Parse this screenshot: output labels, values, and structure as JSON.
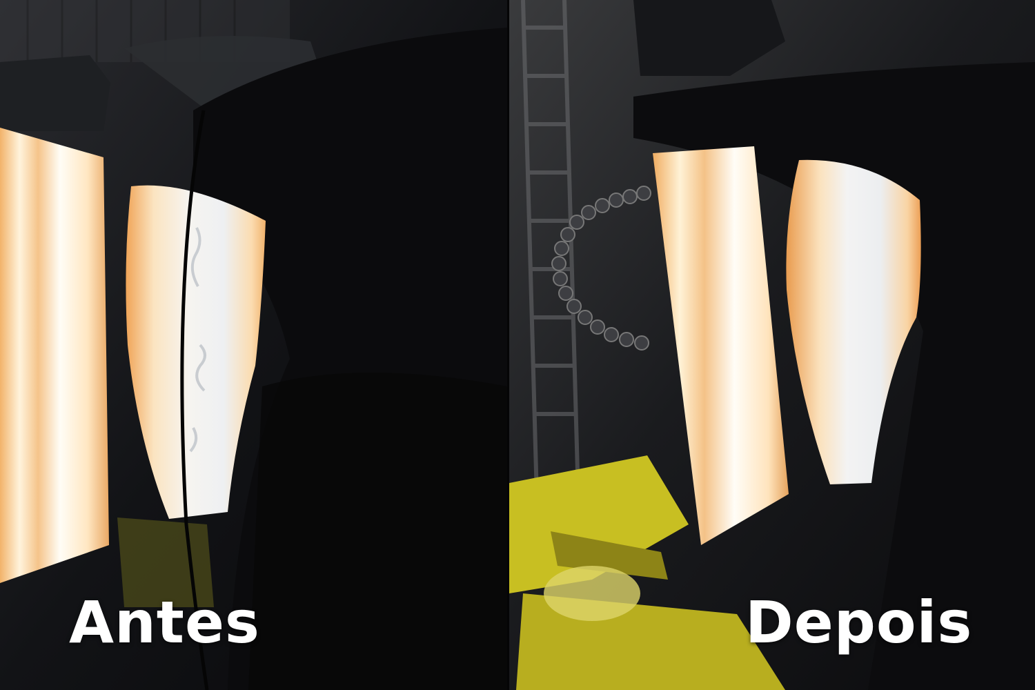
{
  "captions": {
    "before": "Antes",
    "after": "Depois"
  },
  "colors": {
    "caption_text": "#ffffff",
    "lamp_glow": "#ffd79a",
    "lamp_core": "#fffaf0",
    "lift_yellow": "#d9cf2a",
    "background_dark": "#0d0e11"
  }
}
